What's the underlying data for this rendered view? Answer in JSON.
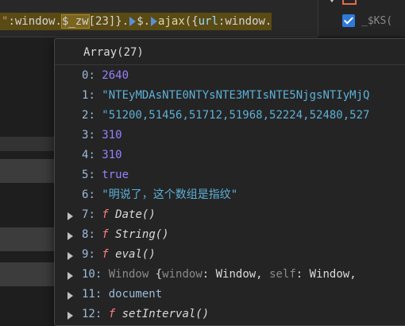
{
  "code": {
    "q": "\"",
    "w1": ":window.",
    "hl": "$_zw",
    "w2": "[23]}",
    "w3": ".",
    "w4": "$.",
    "fn": "ajax",
    "w5": "({",
    "prop": "url",
    "w6": ":window."
  },
  "scope": {
    "checkbox_label": "_$KS("
  },
  "popover": {
    "title": "Array(27)",
    "rows": [
      {
        "key": "0",
        "value": "2640"
      },
      {
        "key": "1",
        "value": "\"NTEyMDAsNTE0NTYsNTE3MTIsNTE5NjgsNTIyMjQ"
      },
      {
        "key": "2",
        "value": "\"51200,51456,51712,51968,52224,52480,527"
      },
      {
        "key": "3",
        "value": "310"
      },
      {
        "key": "4",
        "value": "310"
      },
      {
        "key": "5",
        "value": "true"
      },
      {
        "key": "6",
        "value": "\"明说了，这个数组是指纹\""
      },
      {
        "key": "7",
        "ftag": "f",
        "fname": "Date()"
      },
      {
        "key": "8",
        "ftag": "f",
        "fname": "String()"
      },
      {
        "key": "9",
        "ftag": "f",
        "fname": "eval()"
      },
      {
        "key": "10",
        "type": "Window",
        "open": "{",
        "k1": "window",
        "v1": "Window,",
        "k2": "self",
        "v2": "Window,"
      },
      {
        "key": "11",
        "value": "document"
      },
      {
        "key": "12",
        "ftag": "f",
        "fname": "setInterval()"
      }
    ]
  }
}
